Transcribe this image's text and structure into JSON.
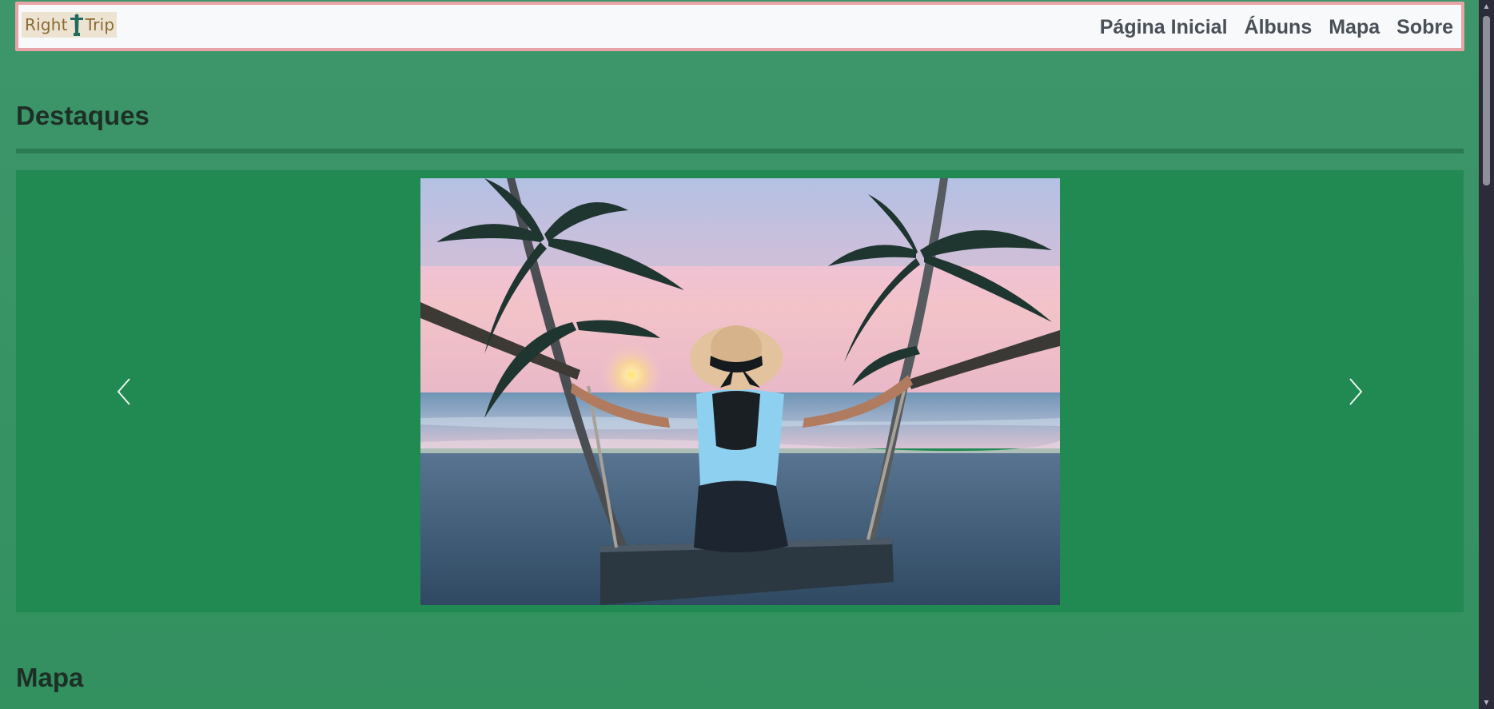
{
  "brand": {
    "left_text": "Right",
    "right_text": "Trip",
    "logo_icon": "christ-redeemer-statue-icon"
  },
  "nav": {
    "items": [
      {
        "label": "Página Inicial"
      },
      {
        "label": "Álbuns"
      },
      {
        "label": "Mapa"
      },
      {
        "label": "Sobre"
      }
    ]
  },
  "highlights": {
    "title": "Destaques",
    "carousel": {
      "prev_icon": "chevron-left-icon",
      "next_icon": "chevron-right-icon",
      "image_alt": "woman-on-beach-swing-photo"
    }
  },
  "map": {
    "title": "Mapa"
  },
  "colors": {
    "page_bg": "#3d966a",
    "carousel_bg": "#218a53",
    "navbar_bg": "#f8f9fa",
    "navbar_border": "#e7a3a6",
    "divider": "#2b7a52",
    "heading": "#1d2f27",
    "nav_text": "#495057"
  }
}
